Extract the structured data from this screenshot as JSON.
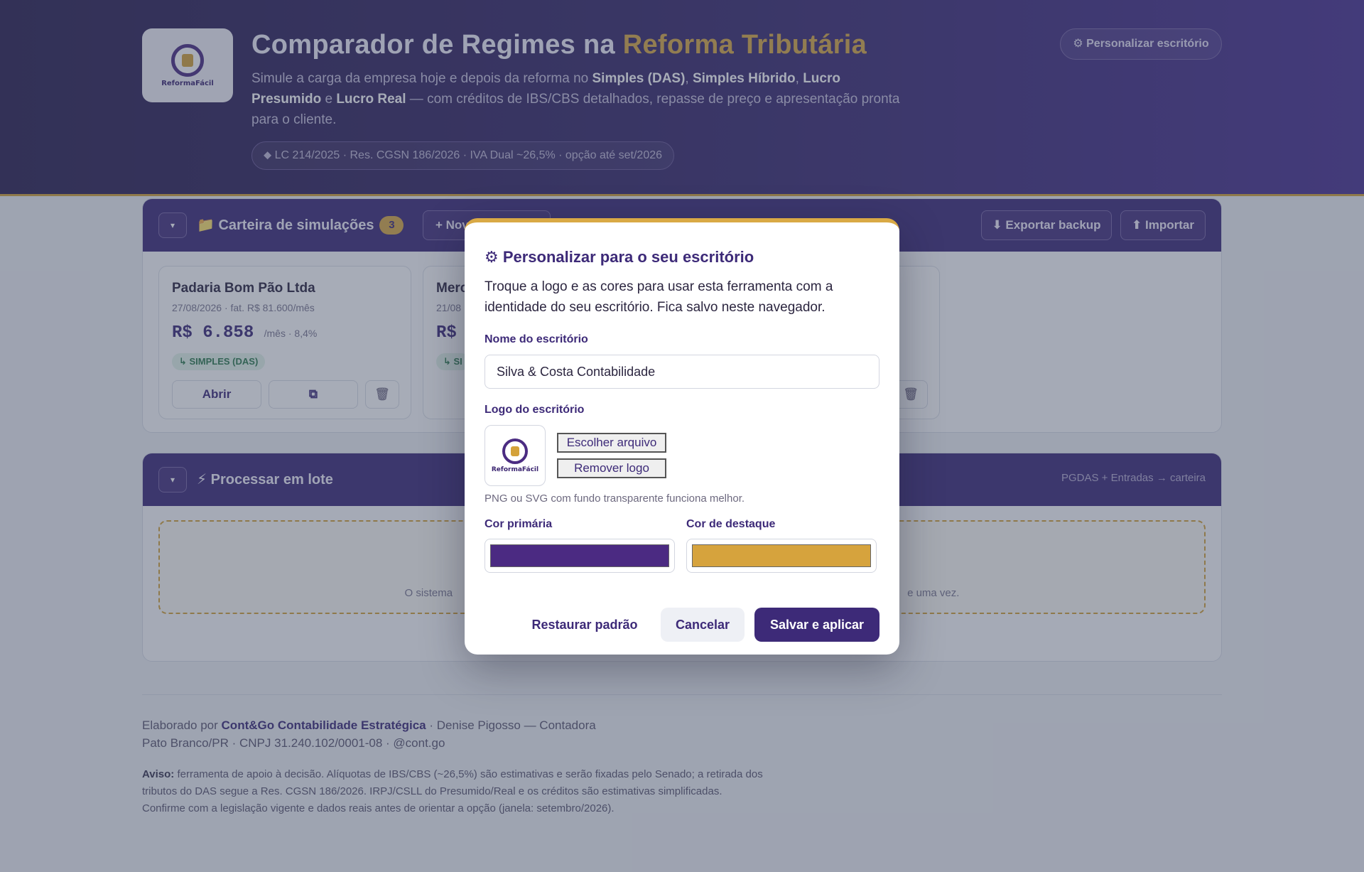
{
  "header": {
    "logo_text": "ReformaFácil",
    "title_main": "Comparador de Regimes na ",
    "title_accent": "Reforma Tributária",
    "subtitle_parts": [
      "Simule a carga da empresa hoje e depois da reforma no ",
      "Simples (DAS)",
      ", ",
      "Simples Híbrido",
      ", ",
      "Lucro Presumido",
      " e ",
      "Lucro Real",
      " — com créditos de IBS/CBS detalhados, repasse de preço e apresentação pronta para o cliente."
    ],
    "pill": "⬥ LC 214/2025 · Res. CGSN 186/2026 · IVA Dual ~26,5% · opção até set/2026",
    "personalize_button": "⚙ Personalizar escritório"
  },
  "portfolio": {
    "collapse_glyph": "▾",
    "title": "📁 Carteira de simulações",
    "count": "3",
    "new_button": "+ Nova simulação",
    "export_button": "⬇ Exportar backup",
    "import_button": "⬆ Importar",
    "cards": [
      {
        "name": "Padaria Bom Pão Ltda",
        "meta": "27/08/2026 · fat. R$ 81.600/mês",
        "value": "R$ 6.858",
        "unit": "/mês · 8,4%",
        "tag": "↳ SIMPLES (DAS)",
        "open_button": "Abrir",
        "duplicate_icon": "⧉",
        "delete_icon": "🗑"
      },
      {
        "name": "Merc",
        "meta": "21/08",
        "value": "R$",
        "tag": "↳ SI",
        "delete_icon": "🗑"
      }
    ]
  },
  "batch": {
    "collapse_glyph": "▾",
    "title": "⚡ Processar em lote",
    "right_text": "PGDAS + Entradas → carteira",
    "drop_text_left": "O sistema",
    "drop_text_right": "e uma vez."
  },
  "footer": {
    "prefix": "Elaborado por ",
    "firm": "Cont&Go Contabilidade Estratégica",
    "suffix": " · Denise Pigosso — Contadora",
    "line2": "Pato Branco/PR · CNPJ 31.240.102/0001-08 · @cont.go",
    "disclaimer_label": "Aviso:",
    "disclaimer_text": " ferramenta de apoio à decisão. Alíquotas de IBS/CBS (~26,5%) são estimativas e serão fixadas pelo Senado; a retirada dos tributos do DAS segue a Res. CGSN 186/2026. IRPJ/CSLL do Presumido/Real e os créditos são estimativas simplificadas. Confirme com a legislação vigente e dados reais antes de orientar a opção (janela: setembro/2026)."
  },
  "modal": {
    "title": "⚙ Personalizar para o seu escritório",
    "description": "Troque a logo e as cores para usar esta ferramenta com a identidade do seu escritório. Fica salvo neste navegador.",
    "name_label": "Nome do escritório",
    "name_value": "Silva & Costa Contabilidade",
    "logo_label": "Logo do escritório",
    "logo_text": "ReformaFácil",
    "choose_file_button": "Escolher arquivo",
    "remove_logo_button": "Remover logo",
    "hint": "PNG ou SVG com fundo transparente funciona melhor.",
    "primary_label": "Cor primária",
    "accent_label": "Cor de destaque",
    "primary_color": "#4b2a82",
    "accent_color": "#d6a33d",
    "restore_button": "Restaurar padrão",
    "cancel_button": "Cancelar",
    "save_button": "Salvar e aplicar"
  }
}
